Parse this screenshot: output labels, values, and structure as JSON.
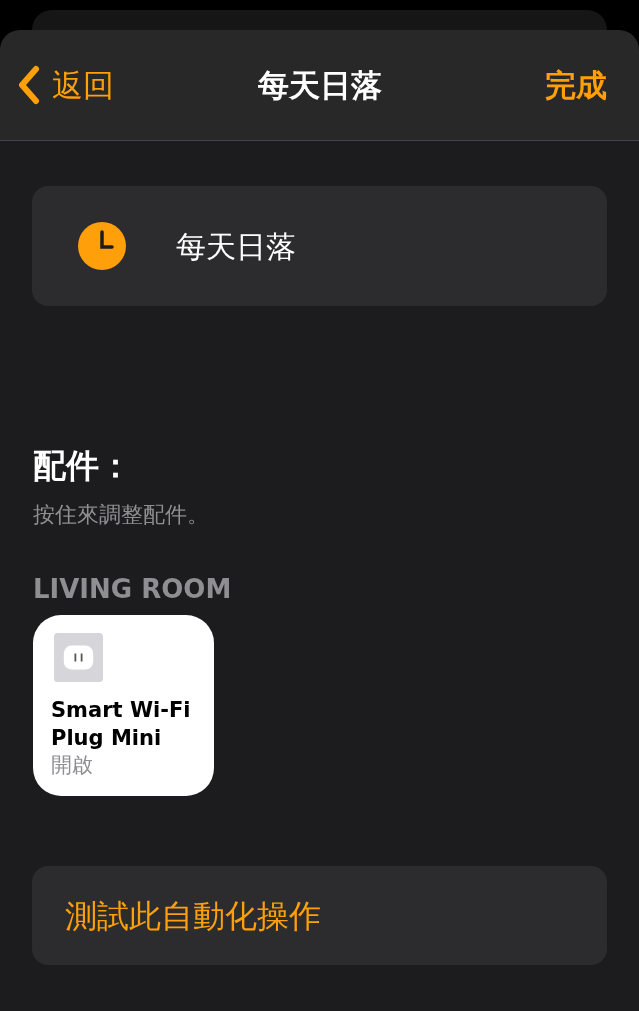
{
  "nav": {
    "back": "返回",
    "title": "每天日落",
    "done": "完成"
  },
  "trigger": {
    "label": "每天日落"
  },
  "accessories": {
    "heading": "配件：",
    "hint": "按住來調整配件。"
  },
  "rooms": [
    {
      "name": "LIVING ROOM",
      "tiles": [
        {
          "name": "Smart Wi-Fi Plug Mini",
          "status": "開啟",
          "on": true
        }
      ]
    }
  ],
  "test_button": "測試此自動化操作"
}
